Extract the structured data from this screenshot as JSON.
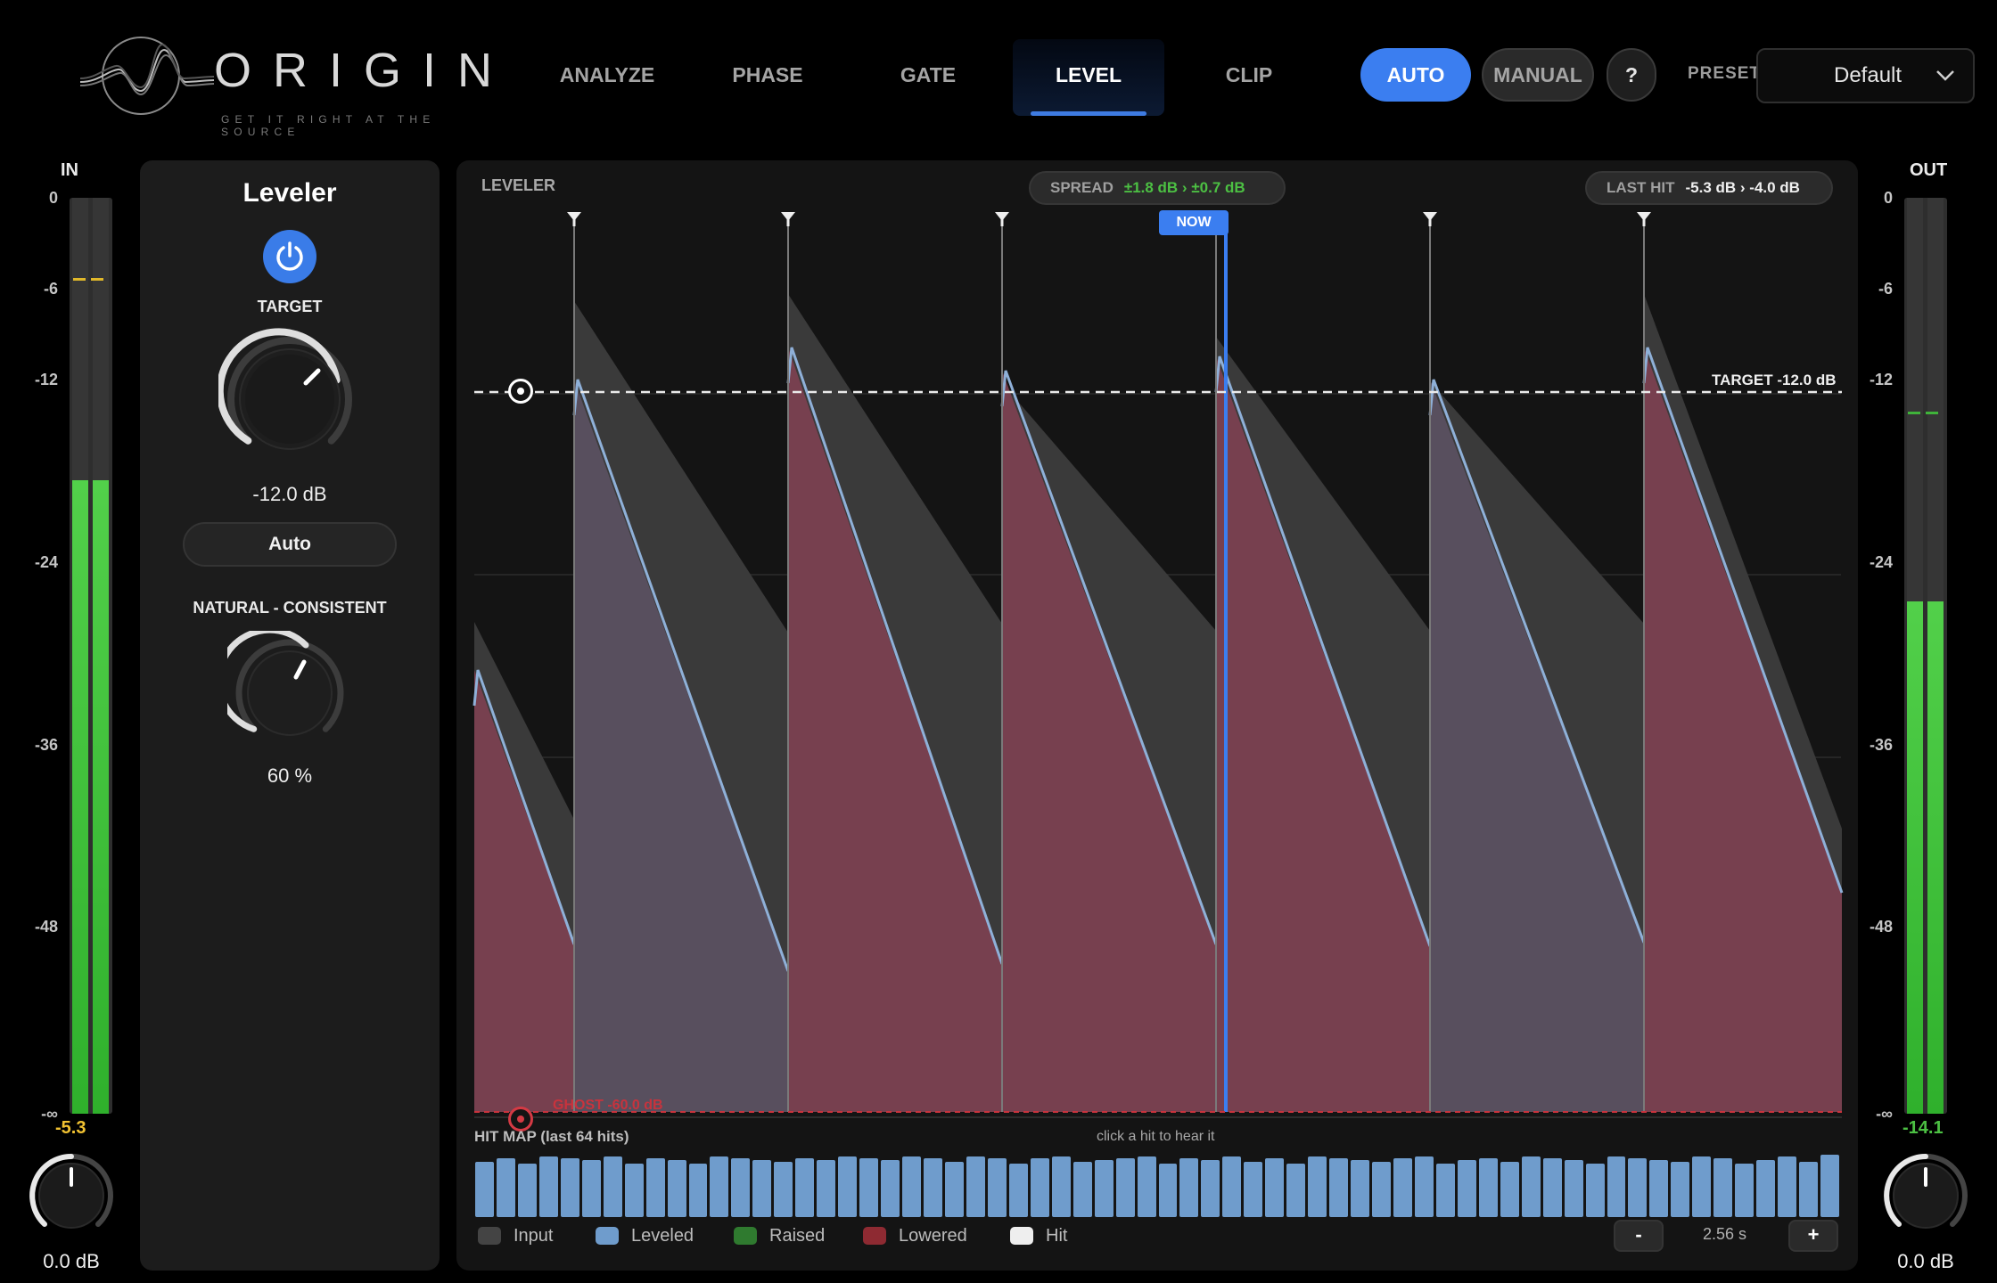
{
  "header": {
    "logo_word": "ORIGIN",
    "logo_tagline": "GET IT RIGHT AT THE SOURCE",
    "tabs": [
      {
        "label": "ANALYZE",
        "active": false
      },
      {
        "label": "PHASE",
        "active": false
      },
      {
        "label": "GATE",
        "active": false
      },
      {
        "label": "LEVEL",
        "active": true
      },
      {
        "label": "CLIP",
        "active": false
      }
    ],
    "mode_auto": "AUTO",
    "mode_manual": "MANUAL",
    "help": "?",
    "preset_label": "PRESET",
    "preset_value": "Default"
  },
  "input_meter": {
    "title": "IN",
    "scale": [
      "0",
      "-6",
      "-12",
      "-24",
      "-36",
      "-48",
      "-∞"
    ],
    "level_db": -18.6,
    "peak_hold_db": -5.3,
    "peak_readout": "-5.3",
    "gain": "0.0 dB"
  },
  "output_meter": {
    "title": "OUT",
    "scale": [
      "0",
      "-6",
      "-12",
      "-24",
      "-36",
      "-48",
      "-∞"
    ],
    "level_db": -26.6,
    "peak_hold_db": -14.1,
    "peak_readout": "-14.1",
    "gain": "0.0 dB"
  },
  "leveler": {
    "title": "Leveler",
    "power_on": true,
    "target_label": "TARGET",
    "target_value": "-12.0 dB",
    "mode_button": "Auto",
    "natural_label": "NATURAL - CONSISTENT",
    "natural_value": "60 %",
    "natural_percent": 60
  },
  "graph": {
    "title": "LEVELER",
    "spread_label": "SPREAD",
    "spread_value": "±1.8 dB › ±0.7 dB",
    "last_hit_label": "LAST HIT",
    "last_hit_value": "-5.3 dB › -4.0 dB",
    "now_label": "NOW",
    "target_line_label": "TARGET -12.0 dB",
    "ghost_label": "GHOST -60.0 dB",
    "hit_map_title": "HIT MAP  (last 64 hits)",
    "hit_map_hint": "click a hit to hear it",
    "zoom_minus": "-",
    "zoom_plus": "+",
    "zoom_value": "2.56 s",
    "legend": [
      {
        "label": "Input",
        "color": "#444444"
      },
      {
        "label": "Leveled",
        "color": "#6f9ccc"
      },
      {
        "label": "Raised",
        "color": "#2f7a2f"
      },
      {
        "label": "Lowered",
        "color": "#8e2a32"
      },
      {
        "label": "Hit",
        "color": "#eeeeee"
      }
    ],
    "colors": {
      "lowered_fill": "#7a4050",
      "leveled_fill": "#5a5060",
      "input_envelope": "#3a3a3a",
      "leveled_line": "#8fb0d8",
      "now_line": "#3b7ef0",
      "accent": "#3b7ef0"
    }
  }
}
